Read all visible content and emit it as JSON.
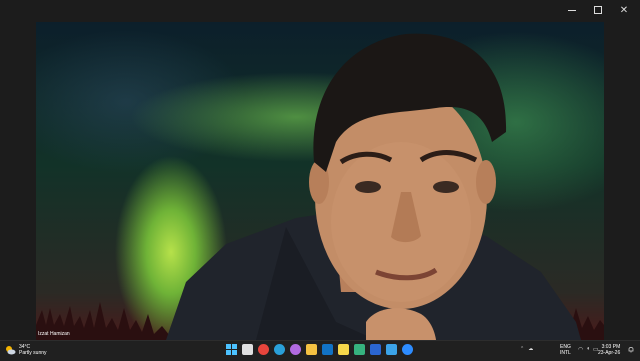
{
  "participant": {
    "name": "Izzat Hamizan"
  },
  "taskbar": {
    "weather": {
      "temperature": "34°C",
      "condition": "Partly sunny",
      "icon": "sun-cloud-icon"
    },
    "pinned": [
      {
        "name": "windows-start-icon",
        "color": "#4cc2ff"
      },
      {
        "name": "task-view-icon",
        "color": "#e0e0e0"
      },
      {
        "name": "chrome-icon",
        "color": "#e8453c"
      },
      {
        "name": "edge-icon",
        "color": "#2aa0d8"
      },
      {
        "name": "copilot-icon",
        "color": "#b36be0"
      },
      {
        "name": "file-explorer-icon",
        "color": "#f5c242"
      },
      {
        "name": "outlook-icon",
        "color": "#1273c4"
      },
      {
        "name": "sticky-notes-icon",
        "color": "#f7d84a"
      },
      {
        "name": "photos-icon",
        "color": "#36b37e"
      },
      {
        "name": "word-icon",
        "color": "#2b66d1"
      },
      {
        "name": "store-icon",
        "color": "#3ba3e8"
      },
      {
        "name": "zoom-icon",
        "color": "#2d8cff"
      }
    ],
    "language": {
      "line1": "ENG",
      "line2": "INTL"
    },
    "clock": {
      "time": "3:03 PM",
      "date": "23-Apr-26"
    }
  }
}
